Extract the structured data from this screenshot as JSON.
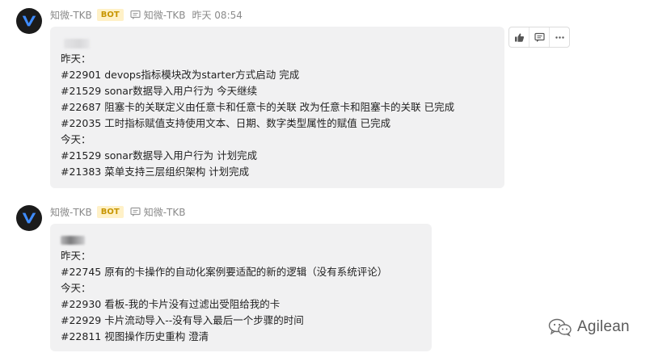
{
  "messages": [
    {
      "sender": "知微-TKB",
      "badge": "BOT",
      "channel": "知微-TKB",
      "time": "昨天 08:54",
      "lines": [
        "昨天：",
        "#22901 devops指标模块改为starter方式启动 完成",
        "#21529 sonar数据导入用户行为 今天继续",
        "#22687 阻塞卡的关联定义由任意卡和任意卡的关联 改为任意卡和阻塞卡的关联 已完成",
        "#22035 工时指标赋值支持使用文本、日期、数字类型属性的赋值 已完成",
        "今天：",
        "#21529 sonar数据导入用户行为 计划完成",
        "#21383 菜单支持三层组织架构 计划完成"
      ]
    },
    {
      "sender": "知微-TKB",
      "badge": "BOT",
      "channel": "知微-TKB",
      "lines": [
        "昨天：",
        "#22745 原有的卡操作的自动化案例要适配的新的逻辑（没有系统评论）",
        "今天：",
        "#22930 看板-我的卡片没有过滤出受阻给我的卡",
        "#22929 卡片流动导入--没有导入最后一个步骤的时间",
        "#22811 视图操作历史重构 澄清"
      ]
    }
  ],
  "message_actions": [
    "thumbs-up-icon",
    "comment-icon",
    "more-icon"
  ],
  "watermark": {
    "text": "Agilean",
    "icon": "wechat-icon"
  },
  "colors": {
    "bubble": "#f1f1f2",
    "badge_bg": "#fff1c7",
    "badge_text": "#c79500",
    "meta": "#8a8a8a"
  }
}
